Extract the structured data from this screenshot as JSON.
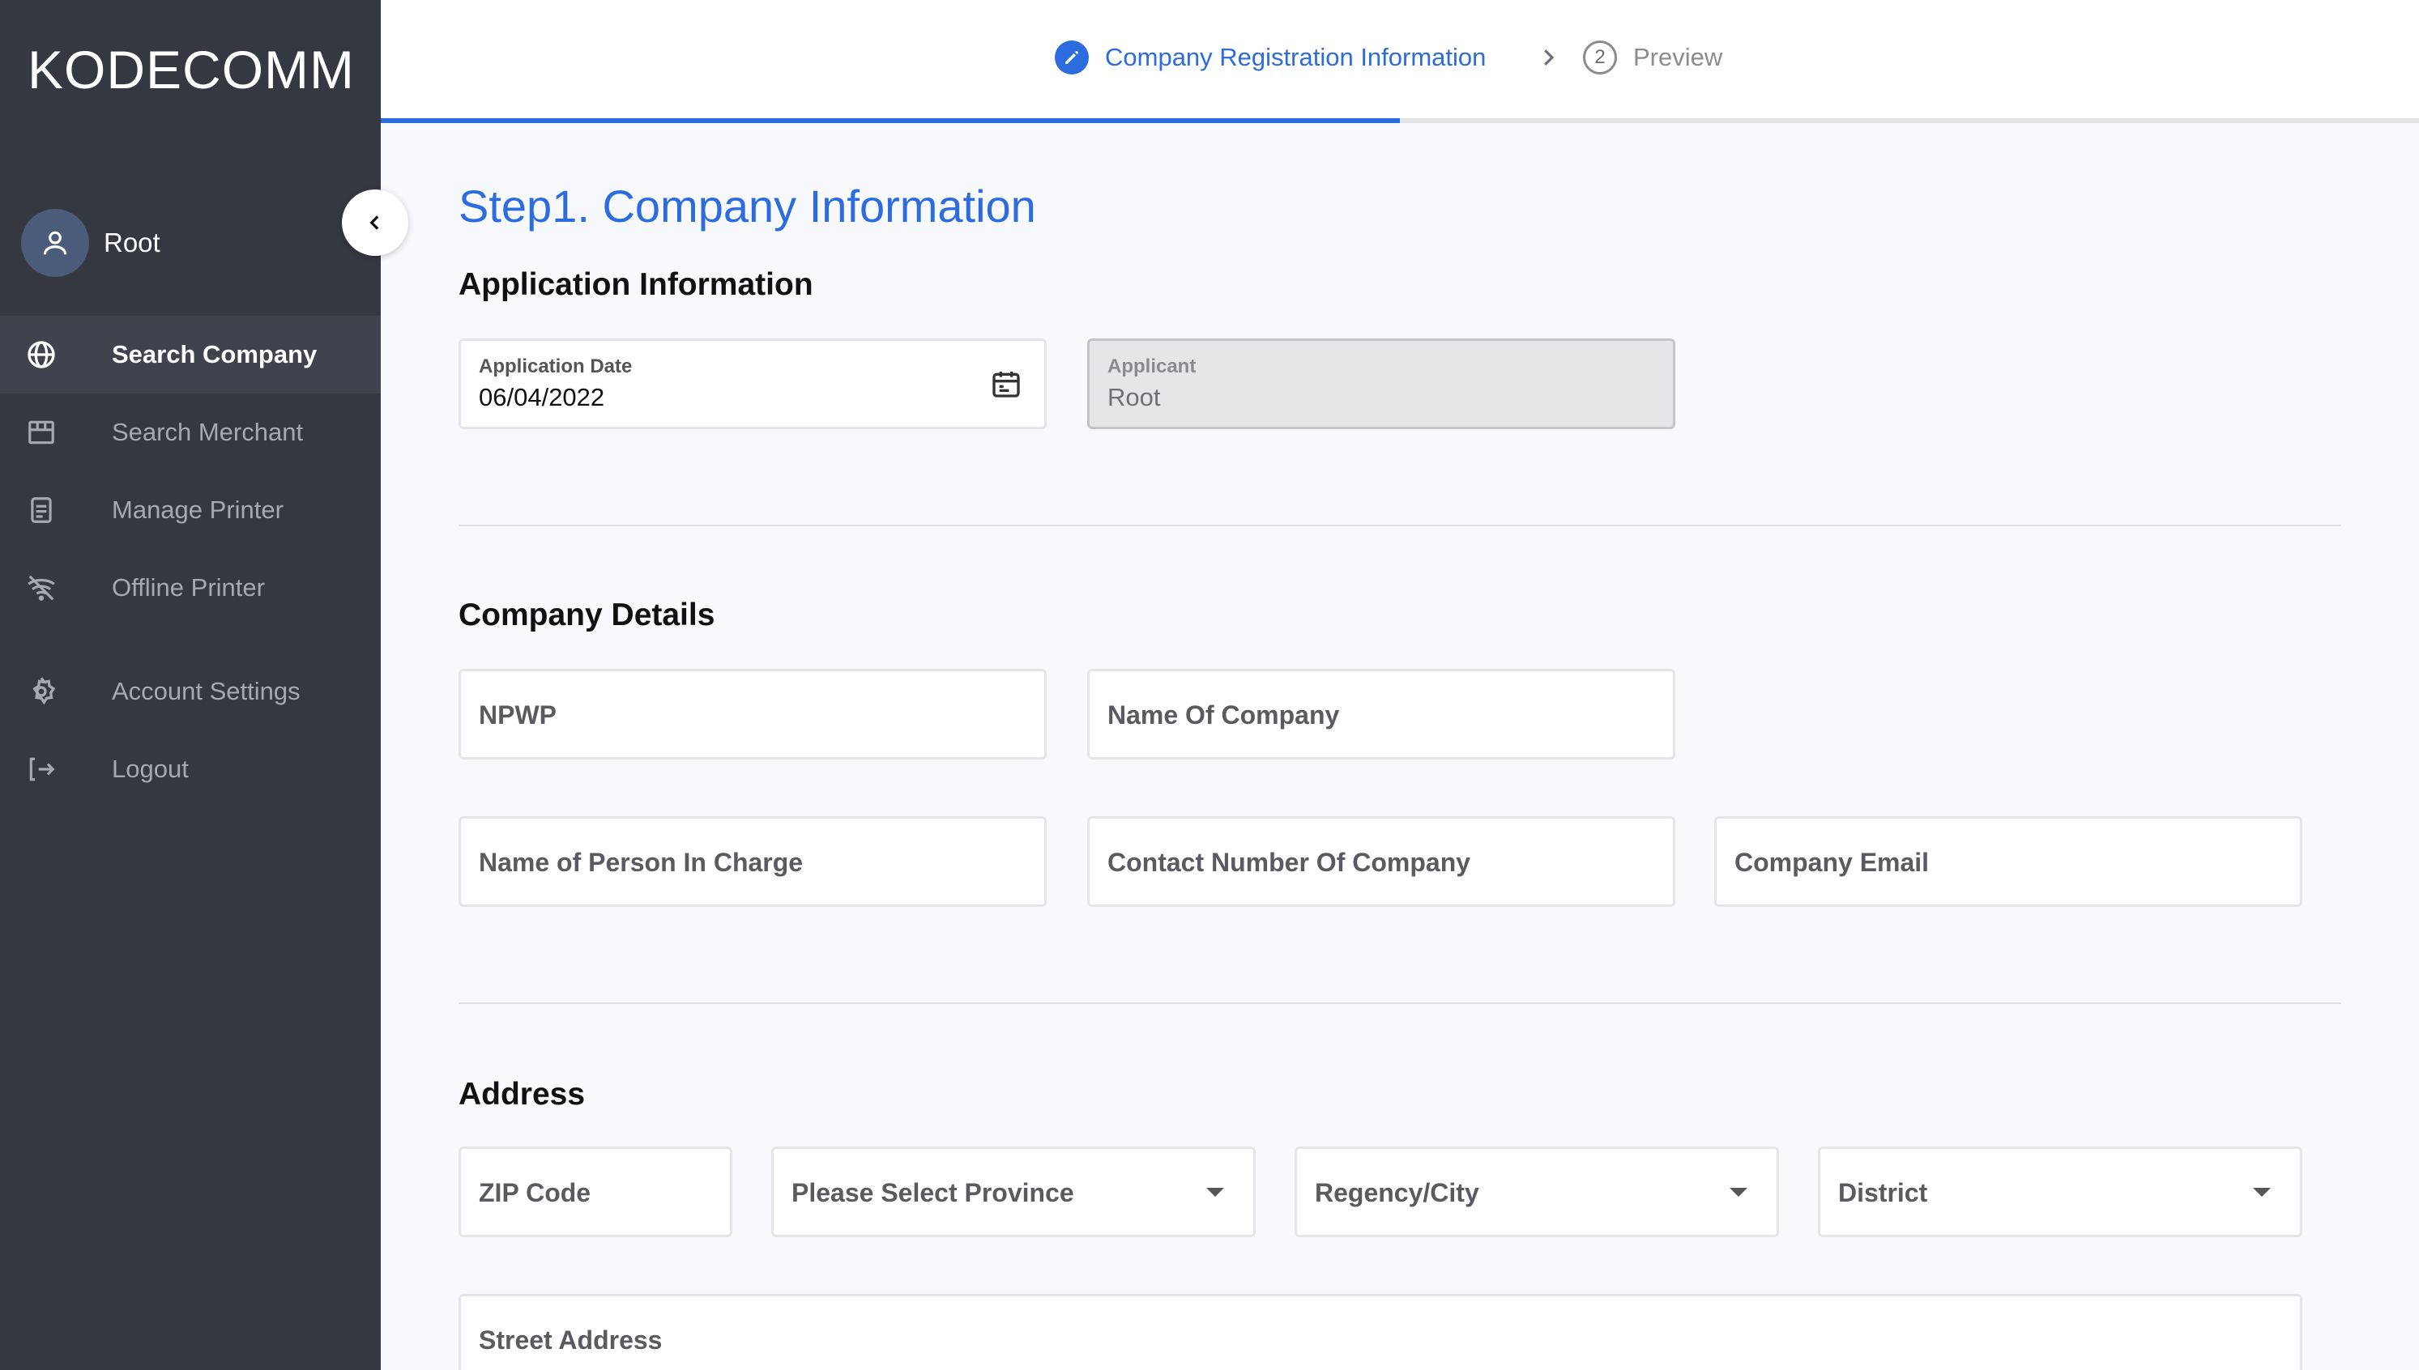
{
  "app": {
    "logo": "KODECOMM"
  },
  "user": {
    "name": "Root"
  },
  "sidebar": {
    "items": [
      {
        "label": "Search Company",
        "icon": "globe-icon",
        "active": true
      },
      {
        "label": "Search Merchant",
        "icon": "store-icon",
        "active": false
      },
      {
        "label": "Manage Printer",
        "icon": "printer-icon",
        "active": false
      },
      {
        "label": "Offline Printer",
        "icon": "wifi-off-icon",
        "active": false
      },
      {
        "label": "Account Settings",
        "icon": "gear-icon",
        "active": false
      },
      {
        "label": "Logout",
        "icon": "logout-icon",
        "active": false
      }
    ]
  },
  "stepper": {
    "steps": [
      {
        "label": "Company Registration Information",
        "state": "active",
        "icon": "pencil-icon"
      },
      {
        "number": "2",
        "label": "Preview",
        "state": "pending"
      }
    ],
    "progress": 0.5
  },
  "page": {
    "title": "Step1. Company Information"
  },
  "application_info": {
    "heading": "Application Information",
    "date_label": "Application Date",
    "date_value": "06/04/2022",
    "applicant_label": "Applicant",
    "applicant_value": "Root"
  },
  "company_details": {
    "heading": "Company Details",
    "npwp": "NPWP",
    "name_of_company": "Name Of Company",
    "person_in_charge": "Name of Person In Charge",
    "contact_number": "Contact Number Of Company",
    "company_email": "Company Email"
  },
  "address": {
    "heading": "Address",
    "zip_code": "ZIP Code",
    "province": "Please Select Province",
    "regency_city": "Regency/City",
    "district": "District",
    "street_address": "Street Address"
  },
  "colors": {
    "sidebar_bg": "#353841",
    "accent": "#2d6cdf",
    "page_bg": "#f8f9fc"
  }
}
